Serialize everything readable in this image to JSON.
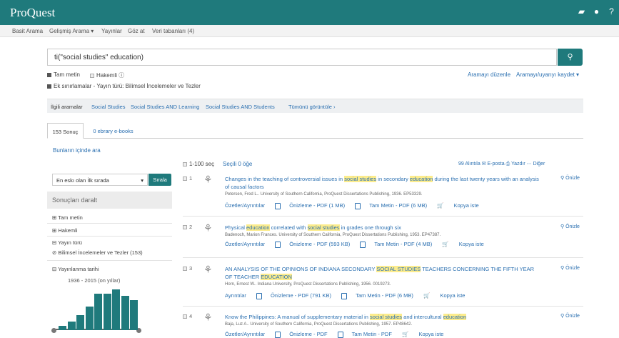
{
  "brand": {
    "logo": "ProQuest",
    "accent": "#1f7a7c"
  },
  "header_icons": [
    "folder-icon",
    "user-icon",
    "help-icon"
  ],
  "nav": {
    "basic": "Basit Arama",
    "advanced": "Gelişmiş Arama ▾",
    "publications": "Yayınlar",
    "browse": "Göz at",
    "databases": "Veri tabanları (4)"
  },
  "search": {
    "query": "ti(\"social studies\" education)"
  },
  "options": {
    "fulltext": "Tam metin",
    "peer": "Hakemli",
    "limits": "Ek sınırlamalar - Yayın türü: Bilimsel İncelemeler ve Tezler",
    "edit": "Aramayı düzenle",
    "save": "Aramayı/uyarıyı kaydet ▾"
  },
  "related": {
    "label": "İlgili aramalar",
    "items": [
      "Social Studies",
      "Social Studies AND Learning",
      "Social Studies AND Students"
    ],
    "show_all": "Tümünü görüntüle ›"
  },
  "tabs": {
    "results": "153 Sonuç",
    "ebooks": "0 ebrary e-books"
  },
  "search_within": "Bunların içinde ara",
  "toolbar": {
    "select_range": "1-100 seç",
    "selected": "Seçili 0 öğe",
    "actions": "99 Alıntıla   ✉ E-posta   ⎙ Yazdır   ⋯ Diğer"
  },
  "sort": {
    "value": "En eskı olan İlk sırada",
    "button": "Sırala"
  },
  "facets": {
    "header": "Sonuçları daralt",
    "fulltext": "Tam metin",
    "peer": "Hakemli",
    "pubtype": "Yayın türü",
    "pubtype_value": "Bilimsel İncelemeler ve Tezler (153)",
    "pubdate": "Yayınlanma tarihi",
    "range": "1936 - 2015 (on yıllar)"
  },
  "histogram": [
    0.1,
    0.2,
    0.35,
    0.55,
    0.85,
    0.85,
    0.95,
    0.8,
    0.7
  ],
  "results": [
    {
      "num": "1",
      "title_parts": [
        "Changes in the teaching of controversial issues in ",
        "social studies",
        " in secondary ",
        "education",
        " during the last twenty years with an analysis of causal factors"
      ],
      "meta": "Petersen, Fred L.. University of Southern California, ProQuest Dissertations Publishing, 1936. EP53329.",
      "links": [
        "Özetler/Ayrıntılar",
        "Önizleme - PDF (1 MB)",
        "Tam Metin - PDF (6 MB)",
        "Kopya iste"
      ],
      "preview": "Önizle"
    },
    {
      "num": "2",
      "title_parts": [
        "Physical ",
        "education",
        " correlated with ",
        "social studies",
        " in grades one through six"
      ],
      "meta": "Badenoch, Marion Frances. University of Southern California, ProQuest Dissertations Publishing, 1953. EP47387.",
      "links": [
        "Özetler/Ayrıntılar",
        "Önizleme - PDF (593 KB)",
        "Tam Metin - PDF (4 MB)",
        "Kopya iste"
      ],
      "preview": "Önizle"
    },
    {
      "num": "3",
      "title_parts": [
        "AN ANALYSIS OF THE OPINIONS OF INDIANA SECONDARY ",
        "SOCIAL STUDIES",
        " TEACHERS CONCERNING THE FIFTH YEAR OF TEACHER ",
        "EDUCATION",
        ""
      ],
      "meta": "Horn, Ernest W.. Indiana University, ProQuest Dissertations Publishing, 1956. 0019273.",
      "links": [
        "Ayrıntılar",
        "Önizleme - PDF (791 KB)",
        "Tam Metin - PDF (6 MB)",
        "Kopya iste"
      ],
      "preview": "Önizle"
    },
    {
      "num": "4",
      "title_parts": [
        "Know the Philippines: A manual of supplementary material in ",
        "social studies",
        " and intercultural ",
        "education",
        ""
      ],
      "meta": "Baja, Luz A.. University of Southern California, ProQuest Dissertations Publishing, 1957. EP48642.",
      "links": [
        "Özetler/Ayrıntılar",
        "Önizleme - PDF",
        "Tam Metin - PDF",
        "Kopya iste"
      ],
      "preview": "Önizle"
    }
  ]
}
